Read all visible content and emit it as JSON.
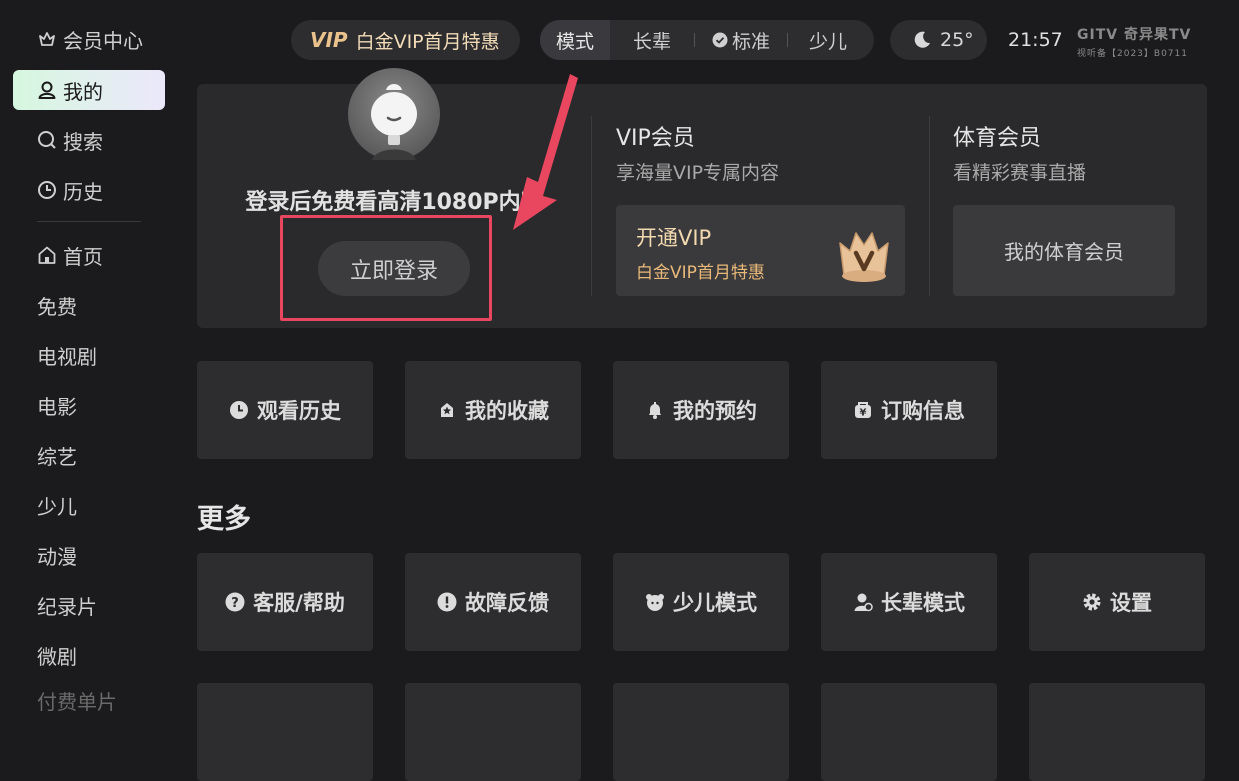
{
  "sidebar": {
    "member_center": "会员中心",
    "mine": "我的",
    "search": "搜索",
    "history": "历史",
    "home": "首页",
    "items": [
      "免费",
      "电视剧",
      "电影",
      "综艺",
      "少儿",
      "动漫",
      "纪录片",
      "微剧"
    ],
    "faded_item": "付费单片"
  },
  "topbar": {
    "vip_tag": "VIP",
    "vip_text": "白金VIP首月特惠",
    "modes": [
      "模式",
      "长辈",
      "标准",
      "少儿"
    ],
    "weather_temp": "25°",
    "time": "21:57",
    "brand_name": "GITV 奇异果TV",
    "brand_license": "视听备【2023】B0711"
  },
  "account": {
    "login_hint": "登录后免费看高清1080P内容",
    "login_button": "立即登录",
    "vip_title": "VIP会员",
    "vip_subtitle": "享海量VIP专属内容",
    "open_vip_title": "开通VIP",
    "open_vip_sub": "白金VIP首月特惠",
    "sports_title": "体育会员",
    "sports_subtitle": "看精彩赛事直播",
    "sports_button": "我的体育会员"
  },
  "quick_tiles": [
    {
      "label": "观看历史",
      "icon": "clock-icon"
    },
    {
      "label": "我的收藏",
      "icon": "star-icon"
    },
    {
      "label": "我的预约",
      "icon": "bell-icon"
    },
    {
      "label": "订购信息",
      "icon": "purse-icon"
    }
  ],
  "more": {
    "title": "更多",
    "tiles": [
      {
        "label": "客服/帮助",
        "icon": "question-icon"
      },
      {
        "label": "故障反馈",
        "icon": "alert-icon"
      },
      {
        "label": "少儿模式",
        "icon": "kid-icon"
      },
      {
        "label": "长辈模式",
        "icon": "elder-icon"
      },
      {
        "label": "设置",
        "icon": "gear-icon"
      }
    ]
  },
  "colors": {
    "background": "#1b1b1d",
    "card": "#2a2a2c",
    "tile": "#2d2d30",
    "vip_gold": "#e9c28c",
    "highlight_red": "#e8475f",
    "active_gradient_start": "#d6f7df",
    "active_gradient_end": "#ece8fb"
  }
}
